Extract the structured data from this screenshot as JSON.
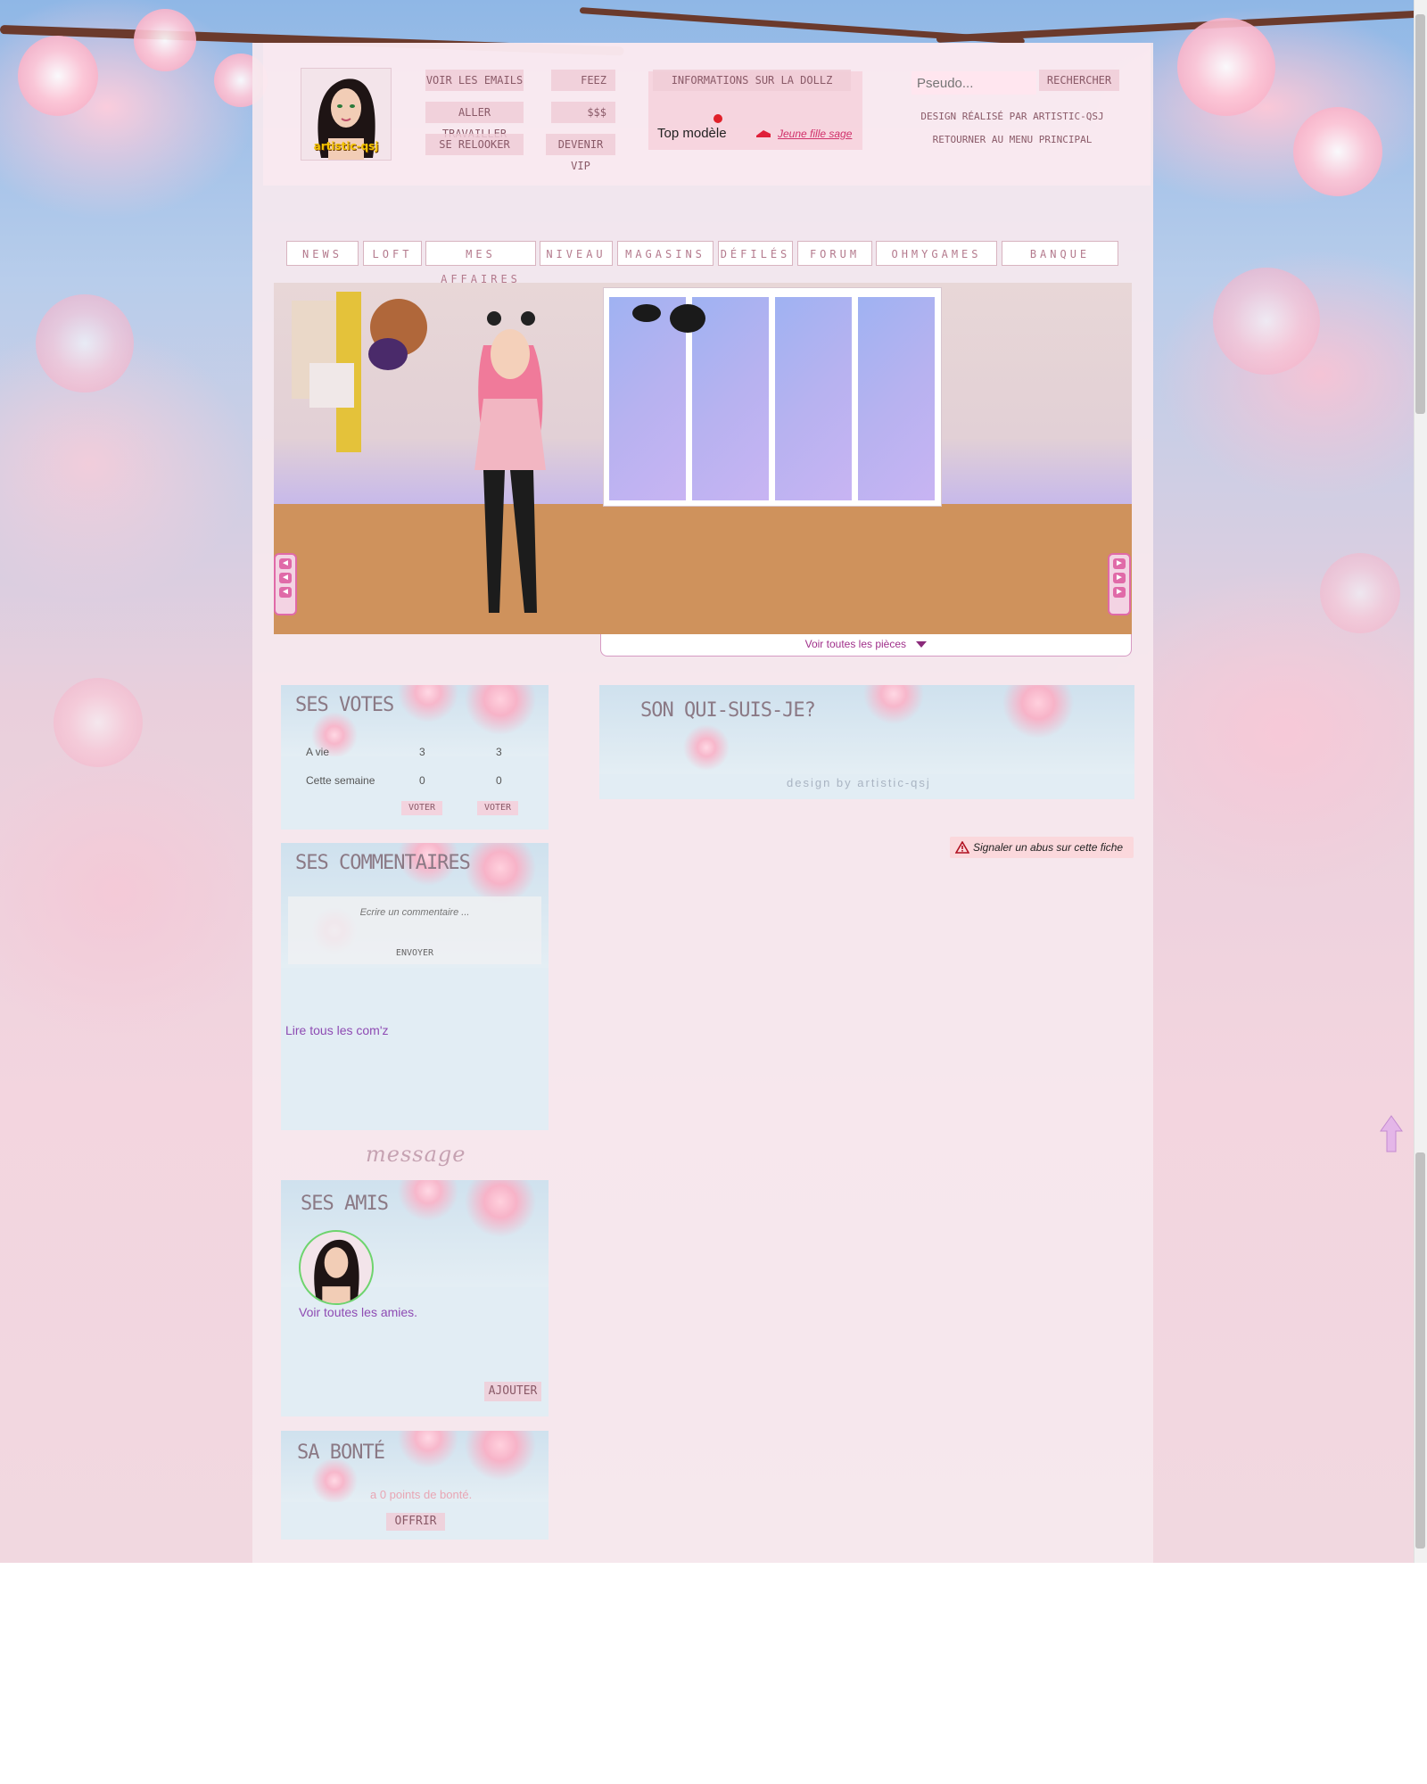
{
  "header": {
    "avatar_label": "artistic-qsj",
    "links_left": [
      "Voir les emails",
      "Aller travailler",
      "Se relooker"
    ],
    "links_mid": [
      "Feez",
      "$$$",
      "Devenir VIP"
    ],
    "info_button": "Informations sur la Dollz",
    "status_label": "Top modèle",
    "status_link": "Jeune fille sage",
    "search_placeholder": "Pseudo...",
    "search_button": "Rechercher",
    "design_credit": "Design réalisé par artistic-qsj",
    "back_link": "Retourner au menu principal"
  },
  "nav": {
    "items": [
      "NEWS",
      "LOFT",
      "MES AFFAIRES",
      "NIVEAU",
      "MAGASINS",
      "DÉFILÉS",
      "FORUM",
      "OHMYGAMES",
      "BANQUE"
    ]
  },
  "room": {
    "view_all_rooms": "Voir toutes les pièces"
  },
  "votes": {
    "title": "SES VOTES",
    "rows": [
      {
        "label": "A vie",
        "a": "3",
        "b": "3"
      },
      {
        "label": "Cette semaine",
        "a": "0",
        "b": "0"
      }
    ],
    "vote_button": "VOTER"
  },
  "comments": {
    "title": "SES COMMENTAIRES",
    "placeholder": "Ecrire un commentaire ...",
    "send_button": "ENVOYER",
    "read_all": "Lire tous les com'z"
  },
  "message_label": "message",
  "friends": {
    "title": "SES AMIS",
    "view_all": "Voir toutes les amies.",
    "add_button": "AJOUTER"
  },
  "kindness": {
    "title": "SA BONTÉ",
    "points": "a 0 points de bonté.",
    "offer_button": "OFFRIR"
  },
  "about": {
    "title": "SON QUI-SUIS-JE?",
    "credit": "design by artistic-qsj"
  },
  "report": {
    "label": "Signaler un abus sur cette fiche"
  },
  "colors": {
    "accent_pink": "#e06aa8",
    "link_purple": "#8e4bb3",
    "panel_blue": "#e2edf4"
  }
}
